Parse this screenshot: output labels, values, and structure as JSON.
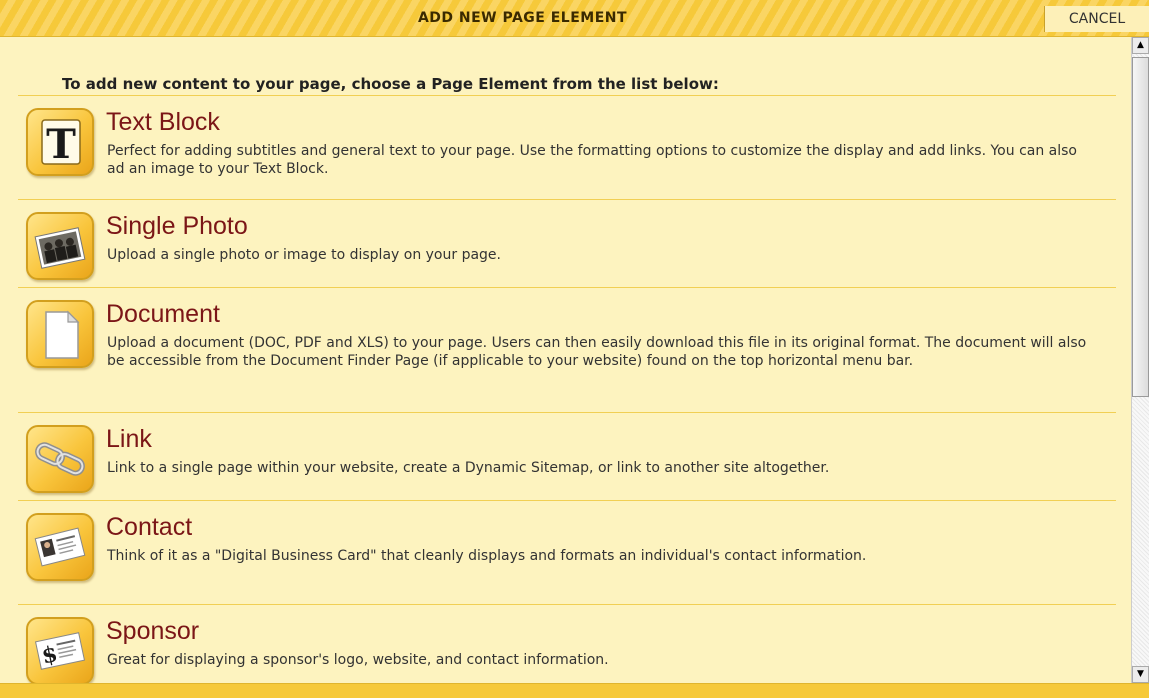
{
  "header": {
    "title": "ADD NEW PAGE ELEMENT",
    "cancel_label": "CANCEL"
  },
  "intro": "To add new content to your page, choose a Page Element from the list below:",
  "elements": [
    {
      "title": "Text Block",
      "description": "Perfect for adding subtitles and general text to your page. Use the formatting options to customize the display and add links. You can also ad an image to your Text Block.",
      "icon": "text-block-icon",
      "icon_glyph": "T"
    },
    {
      "title": "Single Photo",
      "description": "Upload a single photo or image to display on your page.",
      "icon": "photo-icon"
    },
    {
      "title": "Document",
      "description": "Upload a document (DOC, PDF and XLS) to your page. Users can then easily download this file in its original format. The document will also be accessible from the Document Finder Page (if applicable to your website) found on the top horizontal menu bar.",
      "icon": "document-icon"
    },
    {
      "title": "Link",
      "description": "Link to a single page within your website, create a Dynamic Sitemap, or link to another site altogether.",
      "icon": "chain-link-icon"
    },
    {
      "title": "Contact",
      "description": "Think of it as a \"Digital Business Card\" that cleanly displays and formats an individual's contact information.",
      "icon": "business-card-icon"
    },
    {
      "title": "Sponsor",
      "description": "Great for displaying a sponsor's logo, website, and contact information.",
      "icon": "sponsor-card-icon",
      "icon_glyph": "$"
    }
  ],
  "colors": {
    "background": "#fdf3bf",
    "header_stripe": "#f6c93a",
    "title_text": "#7b1617",
    "divider": "#f1cf54"
  }
}
